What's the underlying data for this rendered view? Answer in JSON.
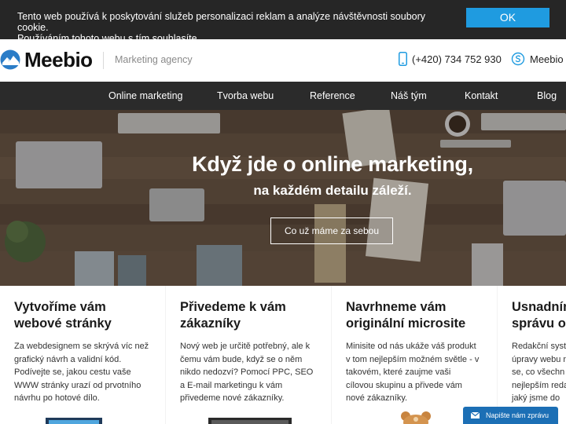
{
  "cookie_bar": {
    "text_line1": "Tento web používá k poskytování služeb personalizaci reklam a analýze návštěvnosti soubory cookie.",
    "text_line2": "Používáním tohoto webu s tím souhlasíte.",
    "ok_label": "OK"
  },
  "header": {
    "logo_text": "Meebio",
    "tagline": "Marketing agency",
    "phone": "(+420) 734 752 930",
    "skype": "Meebio"
  },
  "nav": {
    "items": [
      "Online marketing",
      "Tvorba webu",
      "Reference",
      "Náš tým",
      "Kontakt",
      "Blog"
    ]
  },
  "hero": {
    "title": "Když jde o online marketing,",
    "subtitle": "na každém detailu záleží.",
    "cta_label": "Co už máme za sebou"
  },
  "cards": [
    {
      "title_line1": "Vytvoříme vám",
      "title_line2": "webové stránky",
      "text": [
        "Za webdesignem se skrývá víc než",
        "grafický návrh a validní kód.",
        "Podívejte se, jakou cestu vaše",
        "WWW stránky urazí od prvotního",
        "návrhu po hotové dílo."
      ]
    },
    {
      "title_line1": "Přivedeme k vám",
      "title_line2": "zákazníky",
      "text": [
        "Nový web je určitě potřebný, ale k",
        "čemu vám bude, když se o něm",
        "nikdo nedozví? Pomocí PPC, SEO",
        "a E-mail marketingu k vám",
        "přivedeme nové zákazníky."
      ]
    },
    {
      "title_line1": "Navrhneme vám",
      "title_line2": "originální microsite",
      "text": [
        "Minisite od nás ukáže váš produkt",
        "v tom nejlepším možném světle - v",
        "takovém, které zaujme vaši",
        "cílovou skupinu a přivede vám",
        "nové zákazníky."
      ]
    },
    {
      "title_line1": "Usnadníme",
      "title_line2": "správu ob",
      "text": [
        "Redakční syst",
        "úpravy webu n",
        "se, co všechn",
        "nejlepším reda",
        "jaký jsme do"
      ]
    }
  ],
  "chat": {
    "label": "Napište nám zprávu"
  },
  "colors": {
    "accent": "#1f9be0",
    "nav_bg": "#2b2b2b",
    "cookie_bg": "#262626",
    "chat_bg": "#1c6fb5"
  }
}
